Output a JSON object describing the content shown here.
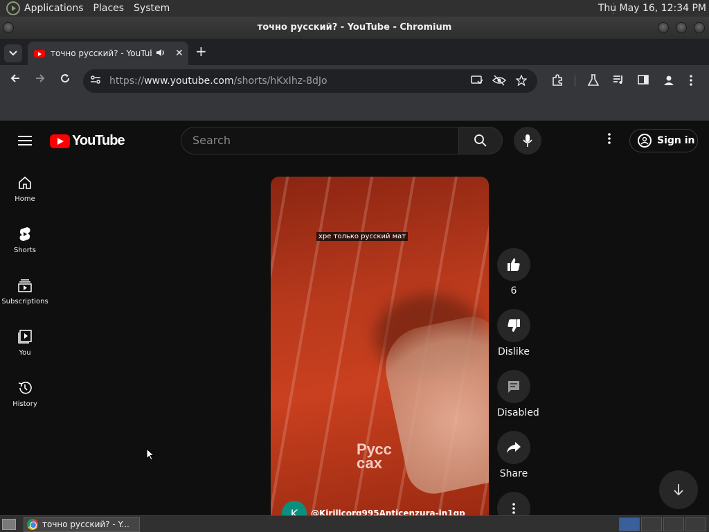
{
  "topbar": {
    "menus": [
      "Applications",
      "Places",
      "System"
    ],
    "clock": "Thu May 16, 12:34 PM"
  },
  "window": {
    "title": "точно русский? - YouTube - Chromium"
  },
  "browser": {
    "tab_title": "точно русский? - YouTube",
    "url_prefix": "https://",
    "url_host": "www.youtube.com",
    "url_path": "/shorts/hKxIhz-8dJo"
  },
  "youtube": {
    "logo_text": "YouTube",
    "search_placeholder": "Search",
    "sign_in": "Sign in",
    "guide": [
      {
        "label": "Home",
        "icon": "home-icon"
      },
      {
        "label": "Shorts",
        "icon": "shorts-icon"
      },
      {
        "label": "Subscriptions",
        "icon": "subscriptions-icon"
      },
      {
        "label": "You",
        "icon": "you-icon"
      },
      {
        "label": "History",
        "icon": "history-icon"
      }
    ],
    "short": {
      "caption": "хре только русский мат",
      "box_text": "Русс\nсах",
      "channel_initial": "K",
      "channel_name": "@Kirillcorg995Anticenzura-in1gp"
    },
    "actions": {
      "likes": "6",
      "dislike": "Dislike",
      "comments": "Disabled",
      "share": "Share"
    }
  },
  "taskbar": {
    "task_title": "точно русский? - Y..."
  },
  "colors": {
    "yt_red": "#ff0000",
    "page_bg": "#0f0f0f",
    "chrome_toolbar": "#35363a"
  }
}
